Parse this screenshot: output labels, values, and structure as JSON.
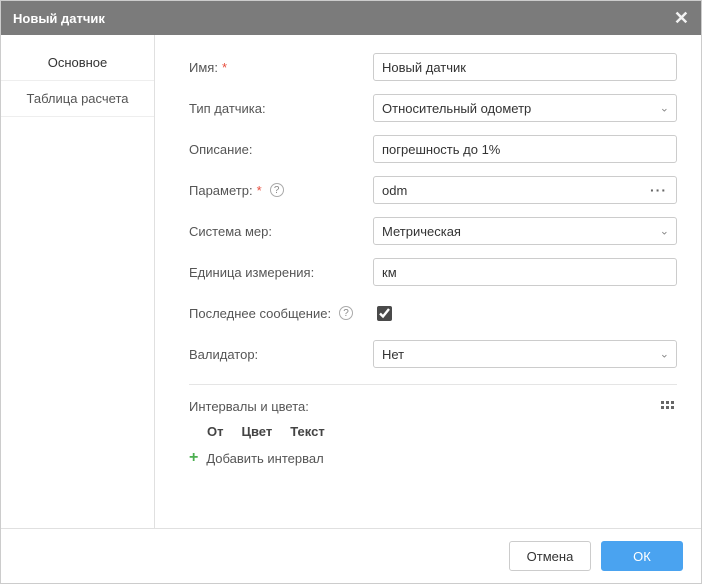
{
  "dialog_title": "Новый датчик",
  "tabs": {
    "basic": "Основное",
    "table": "Таблица расчета"
  },
  "labels": {
    "name": "Имя:",
    "type": "Тип датчика:",
    "description": "Описание:",
    "parameter": "Параметр:",
    "system": "Система мер:",
    "unit": "Единица измерения:",
    "last_msg": "Последнее сообщение:",
    "validator": "Валидатор:"
  },
  "values": {
    "name": "Новый датчик",
    "type": "Относительный одометр",
    "description": "погрешность до 1%",
    "parameter": "odm",
    "system": "Метрическая",
    "unit": "км",
    "last_msg_checked": true,
    "validator": "Нет"
  },
  "intervals": {
    "title": "Интервалы и цвета:",
    "col_from": "От",
    "col_color": "Цвет",
    "col_text": "Текст",
    "add": "Добавить интервал"
  },
  "buttons": {
    "cancel": "Отмена",
    "ok": "ОК"
  }
}
